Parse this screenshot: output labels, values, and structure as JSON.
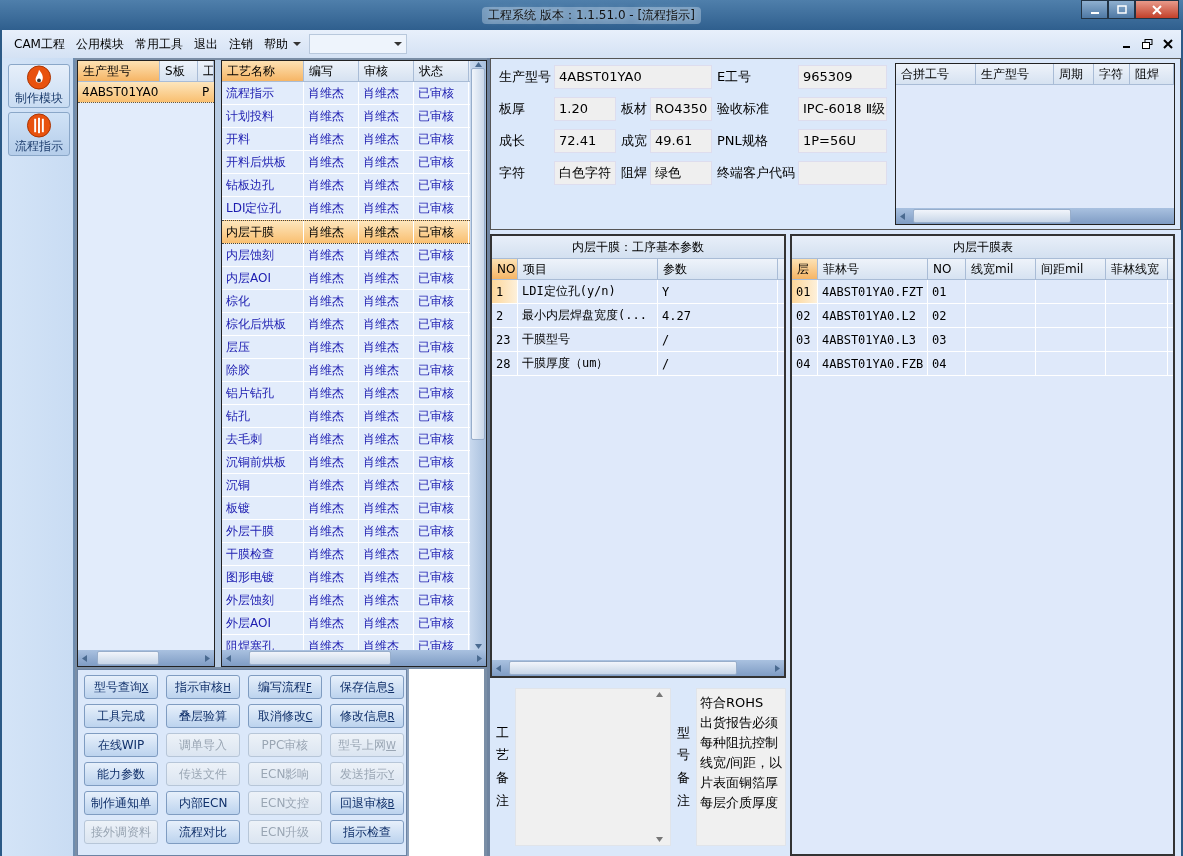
{
  "window": {
    "title": "工程系统   版本：1.1.51.0 - [流程指示]"
  },
  "menu": {
    "items": [
      "CAM工程",
      "公用模块",
      "常用工具",
      "退出",
      "注销",
      "帮助"
    ]
  },
  "nav": [
    {
      "label": "制作模块",
      "kind": "flame",
      "selected": false
    },
    {
      "label": "流程指示",
      "kind": "bars",
      "selected": true
    }
  ],
  "orders": {
    "columns": [
      "生产型号",
      "S板",
      "工"
    ],
    "rows": [
      {
        "model": "4ABST01YA0",
        "column_3": "P",
        "selected": true
      }
    ]
  },
  "process": {
    "columns": [
      "工艺名称",
      "编写",
      "审核",
      "状态"
    ],
    "rows": [
      {
        "cells": [
          "流程指示",
          "肖维杰",
          "肖维杰",
          "已审核"
        ],
        "selected": false
      },
      {
        "cells": [
          "计划投料",
          "肖维杰",
          "肖维杰",
          "已审核"
        ],
        "selected": false
      },
      {
        "cells": [
          "开料",
          "肖维杰",
          "肖维杰",
          "已审核"
        ],
        "selected": false
      },
      {
        "cells": [
          "开料后烘板",
          "肖维杰",
          "肖维杰",
          "已审核"
        ],
        "selected": false
      },
      {
        "cells": [
          "钻板边孔",
          "肖维杰",
          "肖维杰",
          "已审核"
        ],
        "selected": false
      },
      {
        "cells": [
          "LDI定位孔",
          "肖维杰",
          "肖维杰",
          "已审核"
        ],
        "selected": false
      },
      {
        "cells": [
          "内层干膜",
          "肖维杰",
          "肖维杰",
          "已审核"
        ],
        "selected": true
      },
      {
        "cells": [
          "内层蚀刻",
          "肖维杰",
          "肖维杰",
          "已审核"
        ],
        "selected": false
      },
      {
        "cells": [
          "内层AOI",
          "肖维杰",
          "肖维杰",
          "已审核"
        ],
        "selected": false
      },
      {
        "cells": [
          "棕化",
          "肖维杰",
          "肖维杰",
          "已审核"
        ],
        "selected": false
      },
      {
        "cells": [
          "棕化后烘板",
          "肖维杰",
          "肖维杰",
          "已审核"
        ],
        "selected": false
      },
      {
        "cells": [
          "层压",
          "肖维杰",
          "肖维杰",
          "已审核"
        ],
        "selected": false
      },
      {
        "cells": [
          "除胶",
          "肖维杰",
          "肖维杰",
          "已审核"
        ],
        "selected": false
      },
      {
        "cells": [
          "铝片钻孔",
          "肖维杰",
          "肖维杰",
          "已审核"
        ],
        "selected": false
      },
      {
        "cells": [
          "钻孔",
          "肖维杰",
          "肖维杰",
          "已审核"
        ],
        "selected": false
      },
      {
        "cells": [
          "去毛刺",
          "肖维杰",
          "肖维杰",
          "已审核"
        ],
        "selected": false
      },
      {
        "cells": [
          "沉铜前烘板",
          "肖维杰",
          "肖维杰",
          "已审核"
        ],
        "selected": false
      },
      {
        "cells": [
          "沉铜",
          "肖维杰",
          "肖维杰",
          "已审核"
        ],
        "selected": false
      },
      {
        "cells": [
          "板镀",
          "肖维杰",
          "肖维杰",
          "已审核"
        ],
        "selected": false
      },
      {
        "cells": [
          "外层干膜",
          "肖维杰",
          "肖维杰",
          "已审核"
        ],
        "selected": false
      },
      {
        "cells": [
          "干膜检查",
          "肖维杰",
          "肖维杰",
          "已审核"
        ],
        "selected": false
      },
      {
        "cells": [
          "图形电镀",
          "肖维杰",
          "肖维杰",
          "已审核"
        ],
        "selected": false
      },
      {
        "cells": [
          "外层蚀刻",
          "肖维杰",
          "肖维杰",
          "已审核"
        ],
        "selected": false
      },
      {
        "cells": [
          "外层AOI",
          "肖维杰",
          "肖维杰",
          "已审核"
        ],
        "selected": false
      },
      {
        "cells": [
          "阻焊塞孔",
          "肖维杰",
          "肖维杰",
          "已审核"
        ],
        "selected": false
      }
    ]
  },
  "buttons": [
    {
      "label": "型号查询",
      "hotkey": "X",
      "disabled": false
    },
    {
      "label": "指示审核",
      "hotkey": "H",
      "disabled": false
    },
    {
      "label": "编写流程",
      "hotkey": "F",
      "disabled": false
    },
    {
      "label": "保存信息",
      "hotkey": "S",
      "disabled": false
    },
    {
      "label": "工具完成",
      "disabled": false
    },
    {
      "label": "叠层验算",
      "disabled": false
    },
    {
      "label": "取消修改",
      "hotkey": "C",
      "disabled": false
    },
    {
      "label": "修改信息",
      "hotkey": "R",
      "disabled": false
    },
    {
      "label": "在线WIP",
      "disabled": false
    },
    {
      "label": "调单导入",
      "disabled": true
    },
    {
      "label": "PPC审核",
      "disabled": true
    },
    {
      "label": "型号上网",
      "hotkey": "W",
      "disabled": true
    },
    {
      "label": "能力参数",
      "disabled": false
    },
    {
      "label": "传送文件",
      "disabled": true
    },
    {
      "label": "ECN影响",
      "disabled": true
    },
    {
      "label": "发送指示",
      "hotkey": "Y",
      "disabled": true
    },
    {
      "label": "制作通知单",
      "disabled": false
    },
    {
      "label": "内部ECN",
      "disabled": false
    },
    {
      "label": "ECN文控",
      "disabled": true
    },
    {
      "label": "回退审核",
      "hotkey": "B",
      "disabled": false
    },
    {
      "label": "接外调资料",
      "disabled": true
    },
    {
      "label": "流程对比",
      "disabled": false
    },
    {
      "label": "ECN升级",
      "disabled": true
    },
    {
      "label": "指示检查",
      "disabled": false
    }
  ],
  "info": {
    "lines": [
      {
        "fields": [
          {
            "label": "生产型号",
            "value": "4ABST01YA0"
          },
          {
            "label": "E工号",
            "value": "965309"
          }
        ]
      },
      {
        "fields": [
          {
            "label": "板厚",
            "value": "1.20"
          },
          {
            "label": "板材",
            "value": "RO4350"
          },
          {
            "label": "验收标准",
            "value": "IPC-6018 Ⅱ级"
          }
        ]
      },
      {
        "fields": [
          {
            "label": "成长",
            "value": "72.41"
          },
          {
            "label": "成宽",
            "value": "49.61"
          },
          {
            "label": "PNL规格",
            "value": "1P=56U"
          }
        ]
      },
      {
        "fields": [
          {
            "label": "字符",
            "value": "白色字符"
          },
          {
            "label": "阻焊",
            "value": "绿色"
          },
          {
            "label": "终端客户代码"
          }
        ]
      }
    ]
  },
  "merge_table": {
    "columns": [
      "合拼工号",
      "生产型号",
      "周期",
      "字符",
      "阻焊"
    ]
  },
  "params": {
    "title": "内层干膜：工序基本参数",
    "columns": [
      "NO",
      "项目",
      "参数"
    ],
    "rows": [
      {
        "cells": [
          "1",
          "LDI定位孔(y/n)",
          "Y"
        ],
        "selected": true
      },
      {
        "cells": [
          "2",
          "最小内层焊盘宽度(...",
          "4.27"
        ],
        "selected": false
      },
      {
        "cells": [
          "23",
          "干膜型号",
          "/"
        ],
        "selected": false
      },
      {
        "cells": [
          "28",
          "干膜厚度（um）",
          "/"
        ],
        "selected": false
      }
    ]
  },
  "film_table": {
    "title": "内层干膜表",
    "columns": [
      "层",
      "菲林号",
      "NO",
      "线宽mil",
      "间距mil",
      "菲林线宽"
    ],
    "rows": [
      {
        "cells": [
          "01",
          "4ABST01YA0.FZT",
          "01"
        ],
        "selected": true
      },
      {
        "cells": [
          "02",
          "4ABST01YA0.L2",
          "02"
        ],
        "selected": false
      },
      {
        "cells": [
          "03",
          "4ABST01YA0.L3",
          "03"
        ],
        "selected": false
      },
      {
        "cells": [
          "04",
          "4ABST01YA0.FZB",
          "04"
        ],
        "selected": false
      }
    ]
  },
  "notes": {
    "process_label": "工艺备注",
    "model_label": "型号备注",
    "model_lines": [
      "符合ROHS",
      "出货报告必须",
      "每种阻抗控制",
      "线宽/间距，以",
      "片表面铜箔厚",
      "每层介质厚度"
    ]
  }
}
